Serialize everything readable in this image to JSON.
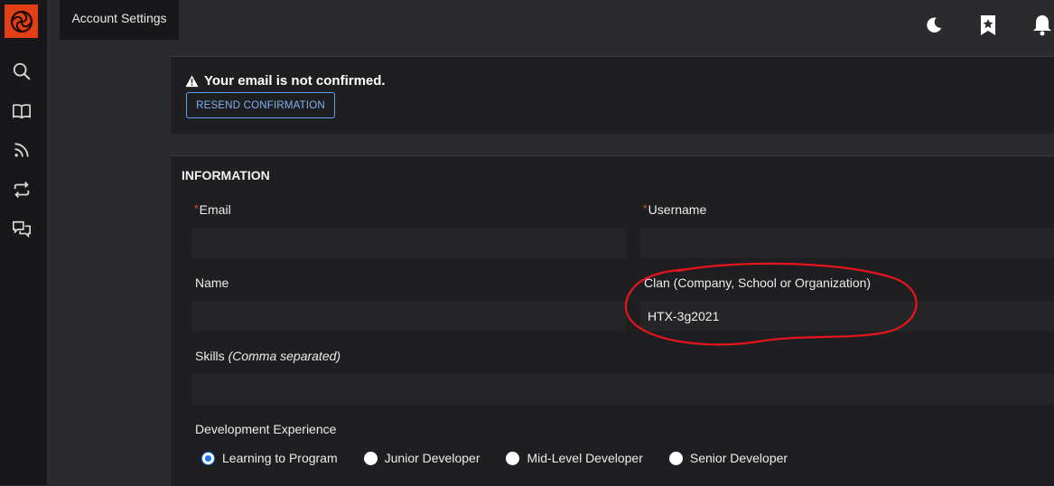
{
  "header": {
    "active_tab": "Account Settings",
    "icons": [
      "moon-icon",
      "bookmark-star-icon",
      "bell-icon"
    ]
  },
  "sidebar": {
    "logo": "brand-logo",
    "icons": [
      "search-icon",
      "book-icon",
      "rss-icon",
      "repeat-icon",
      "chat-icon"
    ]
  },
  "alert": {
    "message": "Your email is not confirmed.",
    "button_label": "RESEND CONFIRMATION"
  },
  "information": {
    "title": "INFORMATION",
    "email_label": "Email",
    "email_value": "",
    "username_label": "Username",
    "username_value": "",
    "name_label": "Name",
    "name_value": "",
    "clan_label": "Clan (Company, School or Organization)",
    "clan_value": "HTX-3g2021",
    "skills_label": "Skills",
    "skills_hint": "(Comma separated)",
    "skills_value": "",
    "experience_label": "Development Experience",
    "experience_options": [
      "Learning to Program",
      "Junior Developer",
      "Mid-Level Developer",
      "Senior Developer"
    ],
    "experience_selected": "Learning to Program"
  },
  "colors": {
    "brand": "#e13f16",
    "accent": "#1a73e8",
    "required": "#e24a2e",
    "annotation": "#e8141c"
  }
}
